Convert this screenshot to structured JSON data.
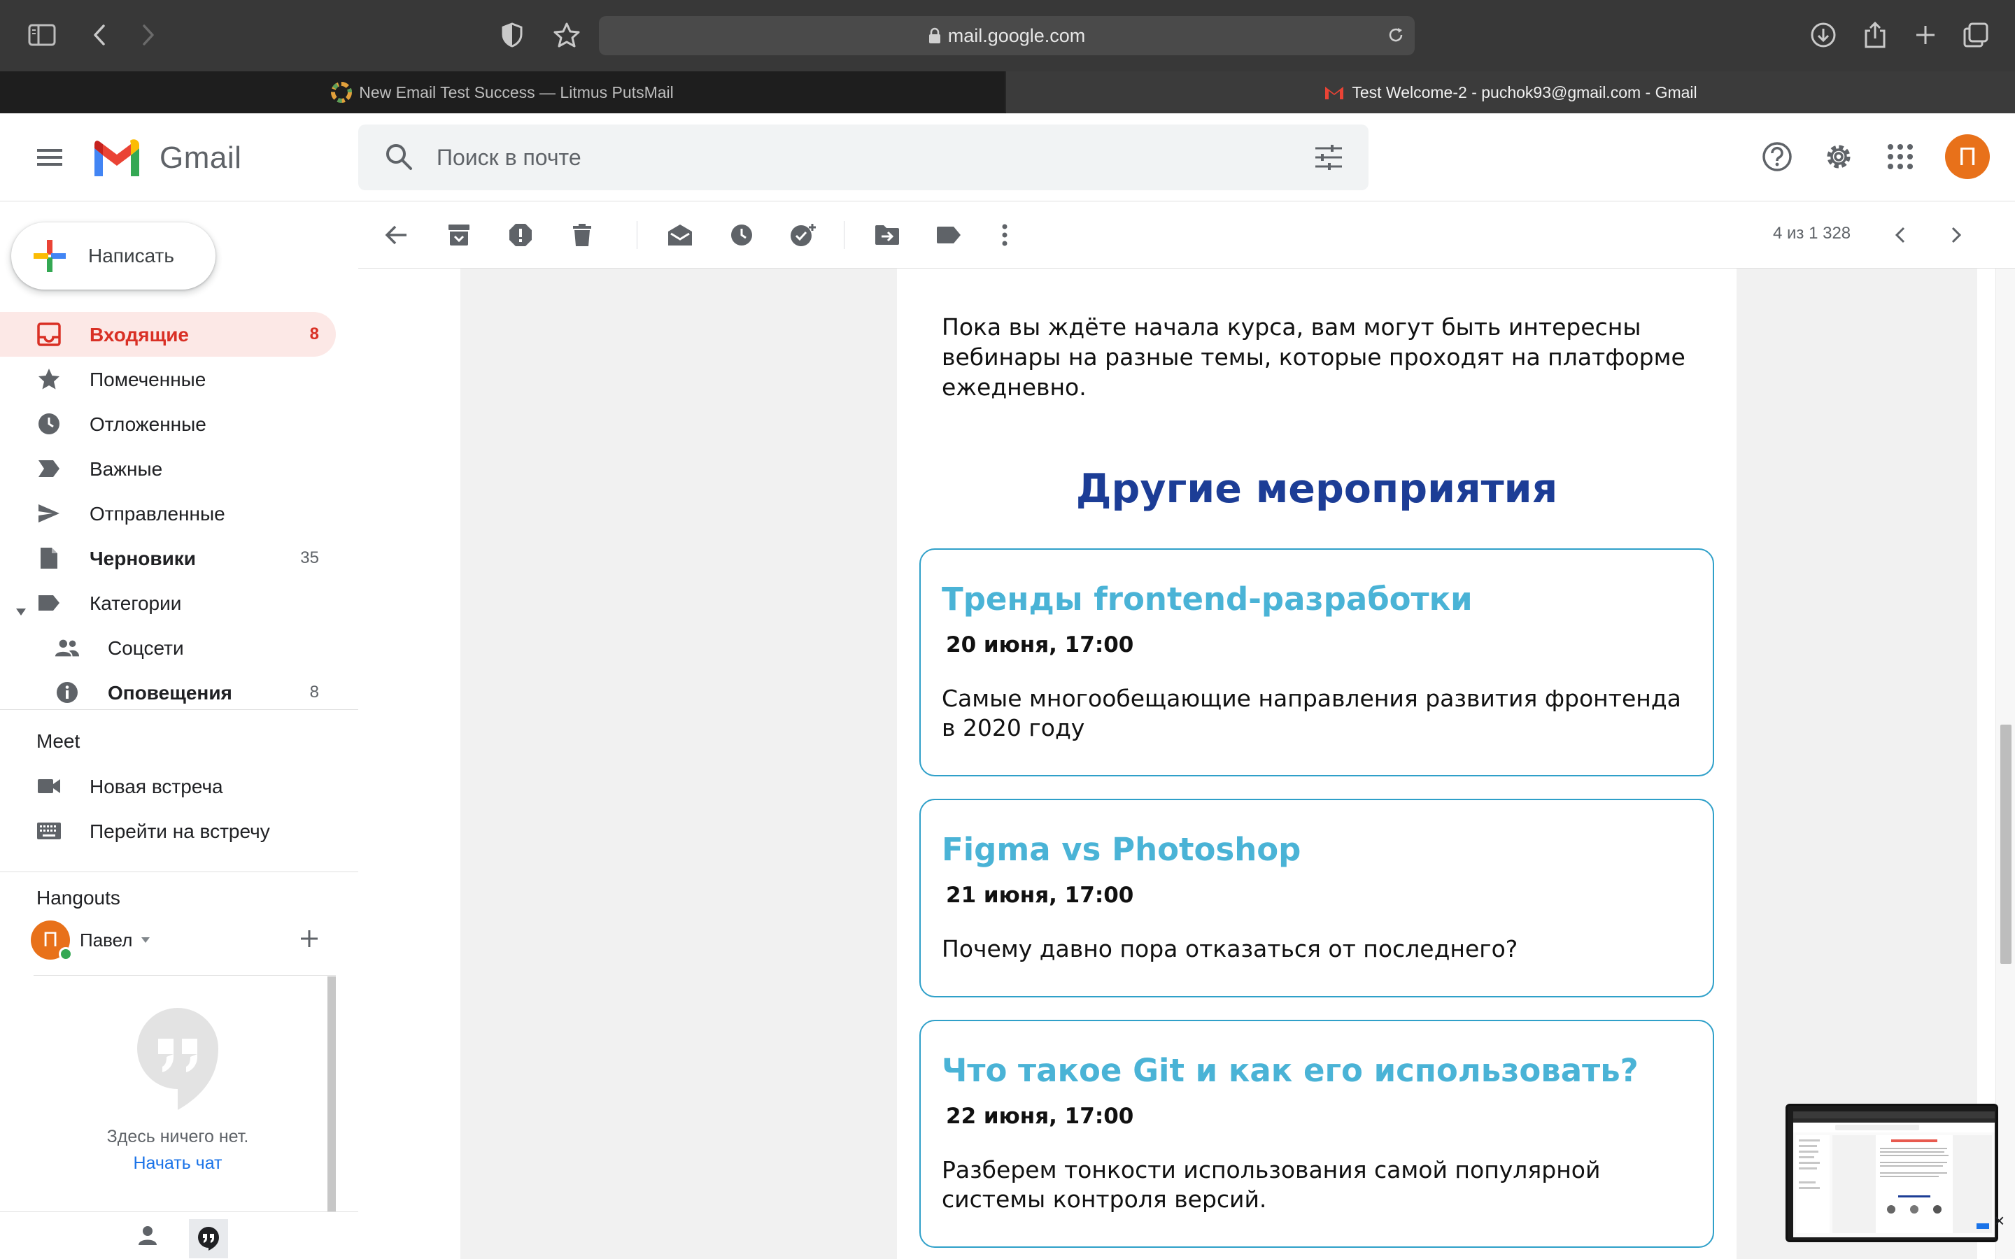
{
  "browser": {
    "url": "mail.google.com",
    "tabs": [
      {
        "title": "New Email Test Success — Litmus PutsMail",
        "active": false
      },
      {
        "title": "Test Welcome-2 - puchok93@gmail.com - Gmail",
        "active": true
      }
    ]
  },
  "gmail": {
    "logo_text": "Gmail",
    "search_placeholder": "Поиск в почте",
    "avatar_letter": "П",
    "compose_label": "Написать",
    "nav": [
      {
        "label": "Входящие",
        "count": "8",
        "icon": "inbox-icon",
        "active": true
      },
      {
        "label": "Помеченные",
        "count": "",
        "icon": "star-icon"
      },
      {
        "label": "Отложенные",
        "count": "",
        "icon": "clock-icon"
      },
      {
        "label": "Важные",
        "count": "",
        "icon": "important-icon"
      },
      {
        "label": "Отправленные",
        "count": "",
        "icon": "send-icon"
      },
      {
        "label": "Черновики",
        "count": "35",
        "icon": "draft-icon",
        "bold": true
      },
      {
        "label": "Категории",
        "count": "",
        "icon": "label-icon"
      },
      {
        "label": "Соцсети",
        "count": "",
        "icon": "people-icon",
        "sub": true
      },
      {
        "label": "Оповещения",
        "count": "8",
        "icon": "info-icon",
        "sub": true,
        "bold": true
      }
    ],
    "meet": {
      "title": "Meet",
      "items": [
        {
          "label": "Новая встреча",
          "icon": "video-icon"
        },
        {
          "label": "Перейти на встречу",
          "icon": "keyboard-icon"
        }
      ]
    },
    "hangouts": {
      "title": "Hangouts",
      "user_name": "Павел",
      "user_letter": "П",
      "empty_text": "Здесь ничего нет.",
      "start_chat": "Начать чат"
    },
    "toolbar": {
      "pager": "4 из 1 328"
    }
  },
  "email": {
    "intro": "Пока вы ждёте начала курса, вам могут быть интересны вебинары на разные темы, которые проходят на платформе ежедневно.",
    "section_title": "Другие мероприятия",
    "events": [
      {
        "title": "Тренды frontend-разработки",
        "date": "20 июня, 17:00",
        "desc": "Самые многообещающие направления развития фронтенда в 2020 году"
      },
      {
        "title": "Figma vs Photoshop",
        "date": "21 июня, 17:00",
        "desc": "Почему давно пора отказаться от последнего?"
      },
      {
        "title": "Что такое Git и как его использовать?",
        "date": "22 июня, 17:00",
        "desc": "Разберем тонкости использования самой популярной системы контроля версий."
      }
    ]
  },
  "colors": {
    "gmail_red": "#d93025",
    "heading_blue": "#1c3d96",
    "event_title": "#4ab3d6",
    "event_border": "#2fa0c9",
    "avatar": "#e8711a"
  }
}
